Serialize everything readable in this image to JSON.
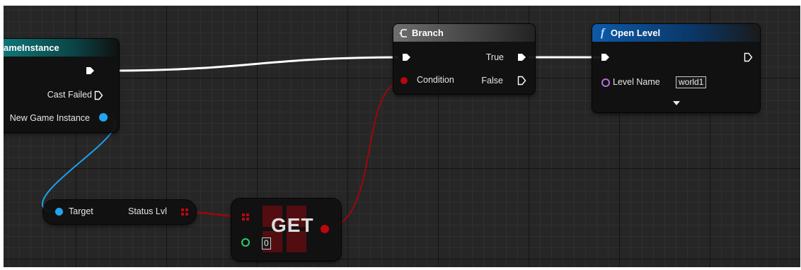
{
  "cast_node": {
    "title": "ameInstance",
    "cast_failed_label": "Cast Failed",
    "new_game_instance_label": "New Game Instance"
  },
  "branch_node": {
    "title": "Branch",
    "condition_label": "Condition",
    "true_label": "True",
    "false_label": "False"
  },
  "open_level_node": {
    "title": "Open Level",
    "function_icon": "f",
    "level_name_label": "Level Name",
    "level_name_value": "world1"
  },
  "getter_node": {
    "target_label": "Target",
    "status_lvl_label": "Status Lvl"
  },
  "get_node": {
    "label": "GET",
    "index_value": "0"
  },
  "colors": {
    "exec": "#ffffff",
    "object": "#22a4f0",
    "boolean": "#b8070d",
    "integer": "#2ecc71",
    "name": "#b070e0",
    "branch_header": "#6e6e6e",
    "function_header": "#0d5aa8",
    "cast_header": "#0f7f80"
  }
}
